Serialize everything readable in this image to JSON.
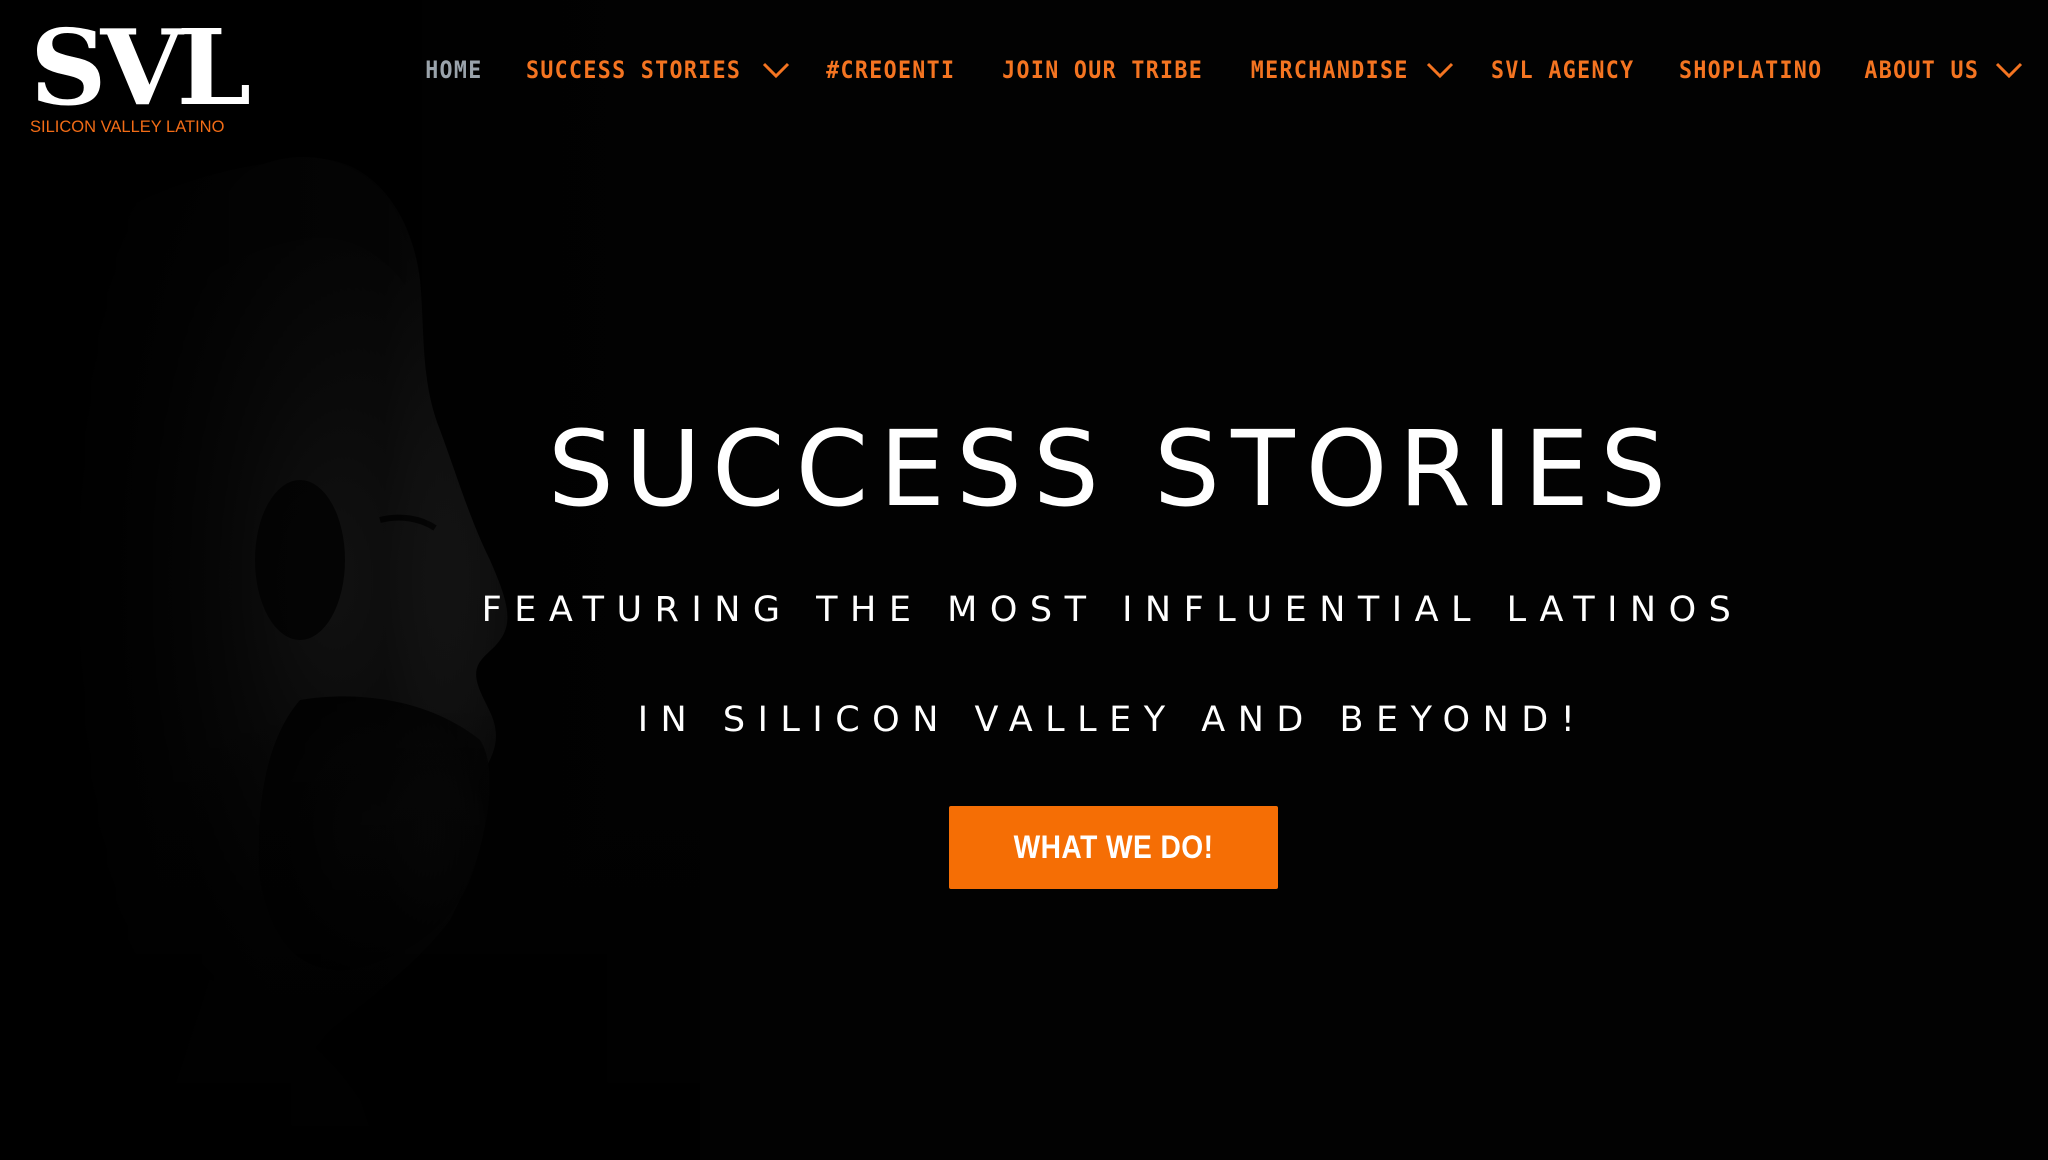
{
  "brand": {
    "logo_mark": "SVL",
    "logo_subtitle": "SILICON VALLEY LATINO",
    "accent_color": "#f56e05",
    "nav_color": "#f47421",
    "active_nav_color": "#9aa3ab"
  },
  "nav": {
    "items": [
      {
        "label": "HOME",
        "active": true,
        "has_dropdown": false
      },
      {
        "label": "SUCCESS STORIES",
        "active": false,
        "has_dropdown": true
      },
      {
        "label": "#CREOENTI",
        "active": false,
        "has_dropdown": false
      },
      {
        "label": "JOIN OUR TRIBE",
        "active": false,
        "has_dropdown": false
      },
      {
        "label": "MERCHANDISE",
        "active": false,
        "has_dropdown": true
      },
      {
        "label": "SVL AGENCY",
        "active": false,
        "has_dropdown": false
      },
      {
        "label": "SHOPLATINO",
        "active": false,
        "has_dropdown": false
      },
      {
        "label": "ABOUT US",
        "active": false,
        "has_dropdown": true
      }
    ],
    "dropdown_icon": "chevron-down-icon"
  },
  "hero": {
    "title": "SUCCESS STORIES",
    "subtitle_line1": "FEATURING THE MOST INFLUENTIAL LATINOS",
    "subtitle_line2": "IN SILICON VALLEY AND BEYOND!",
    "cta_label": "WHAT WE DO!",
    "background_image": "portrait-profile-photo"
  }
}
